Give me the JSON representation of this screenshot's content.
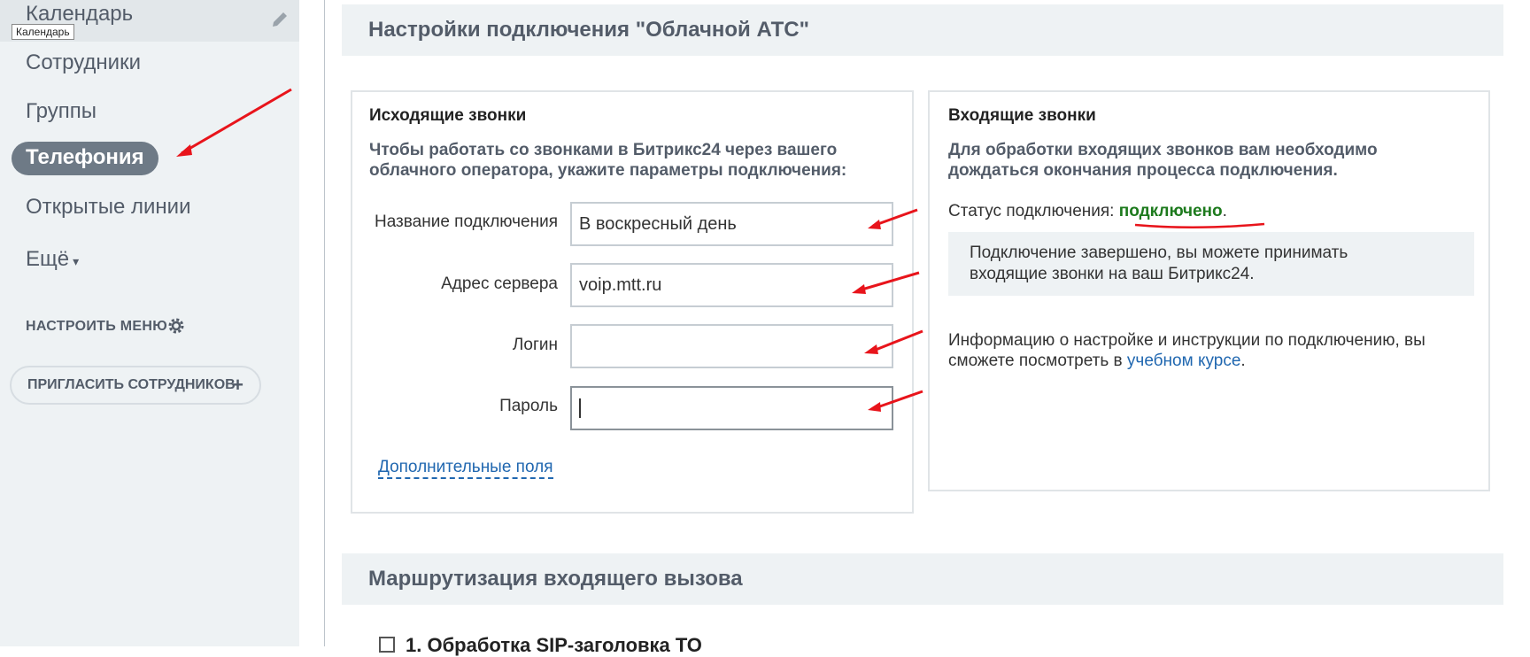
{
  "sidebar": {
    "items": [
      {
        "label": "Календарь"
      },
      {
        "label": "Сотрудники"
      },
      {
        "label": "Группы"
      },
      {
        "label": "Телефония"
      },
      {
        "label": "Открытые линии"
      },
      {
        "label": "Ещё"
      }
    ],
    "tooltip": "Календарь",
    "configure_label": "НАСТРОИТЬ МЕНЮ",
    "invite_label": "ПРИГЛАСИТЬ СОТРУДНИКОВ",
    "invite_plus": "+"
  },
  "main": {
    "section_title": "Настройки подключения \"Облачной АТС\"",
    "outgoing": {
      "title": "Исходящие звонки",
      "desc_line1": "Чтобы работать со звонками в Битрикс24 через вашего",
      "desc_line2": "облачного оператора, укажите параметры подключения:",
      "fields": [
        {
          "label": "Название подключения",
          "value": "В воскресный день"
        },
        {
          "label": "Адрес сервера",
          "value": "voip.mtt.ru"
        },
        {
          "label": "Логин",
          "value": ""
        },
        {
          "label": "Пароль",
          "value": ""
        }
      ],
      "more_fields_link": "Дополнительные поля"
    },
    "incoming": {
      "title": "Входящие звонки",
      "desc_line1": "Для обработки входящих звонков вам необходимо",
      "desc_line2": "дождаться окончания процесса подключения.",
      "status_label": "Статус подключения: ",
      "status_value": "подключено",
      "status_dot": ".",
      "info_line1": "Подключение завершено, вы можете принимать",
      "info_line2": "входящие звонки на ваш Битрикс24.",
      "instructions_text": "Информацию о настройке и инструкции по подключению, вы сможете посмотреть в ",
      "course_link": "учебном курсе",
      "instructions_end": "."
    },
    "routing_title": "Маршрутизация входящего вызова",
    "routing_item": "1. Обработка SIP-заголовка ТО"
  },
  "colors": {
    "sidebar_bg": "#eef2f4",
    "active_item_bg": "#6e7a86",
    "link": "#2067b0",
    "status_ok": "#1d7a1d",
    "annotation_arrow": "#e8141b"
  }
}
